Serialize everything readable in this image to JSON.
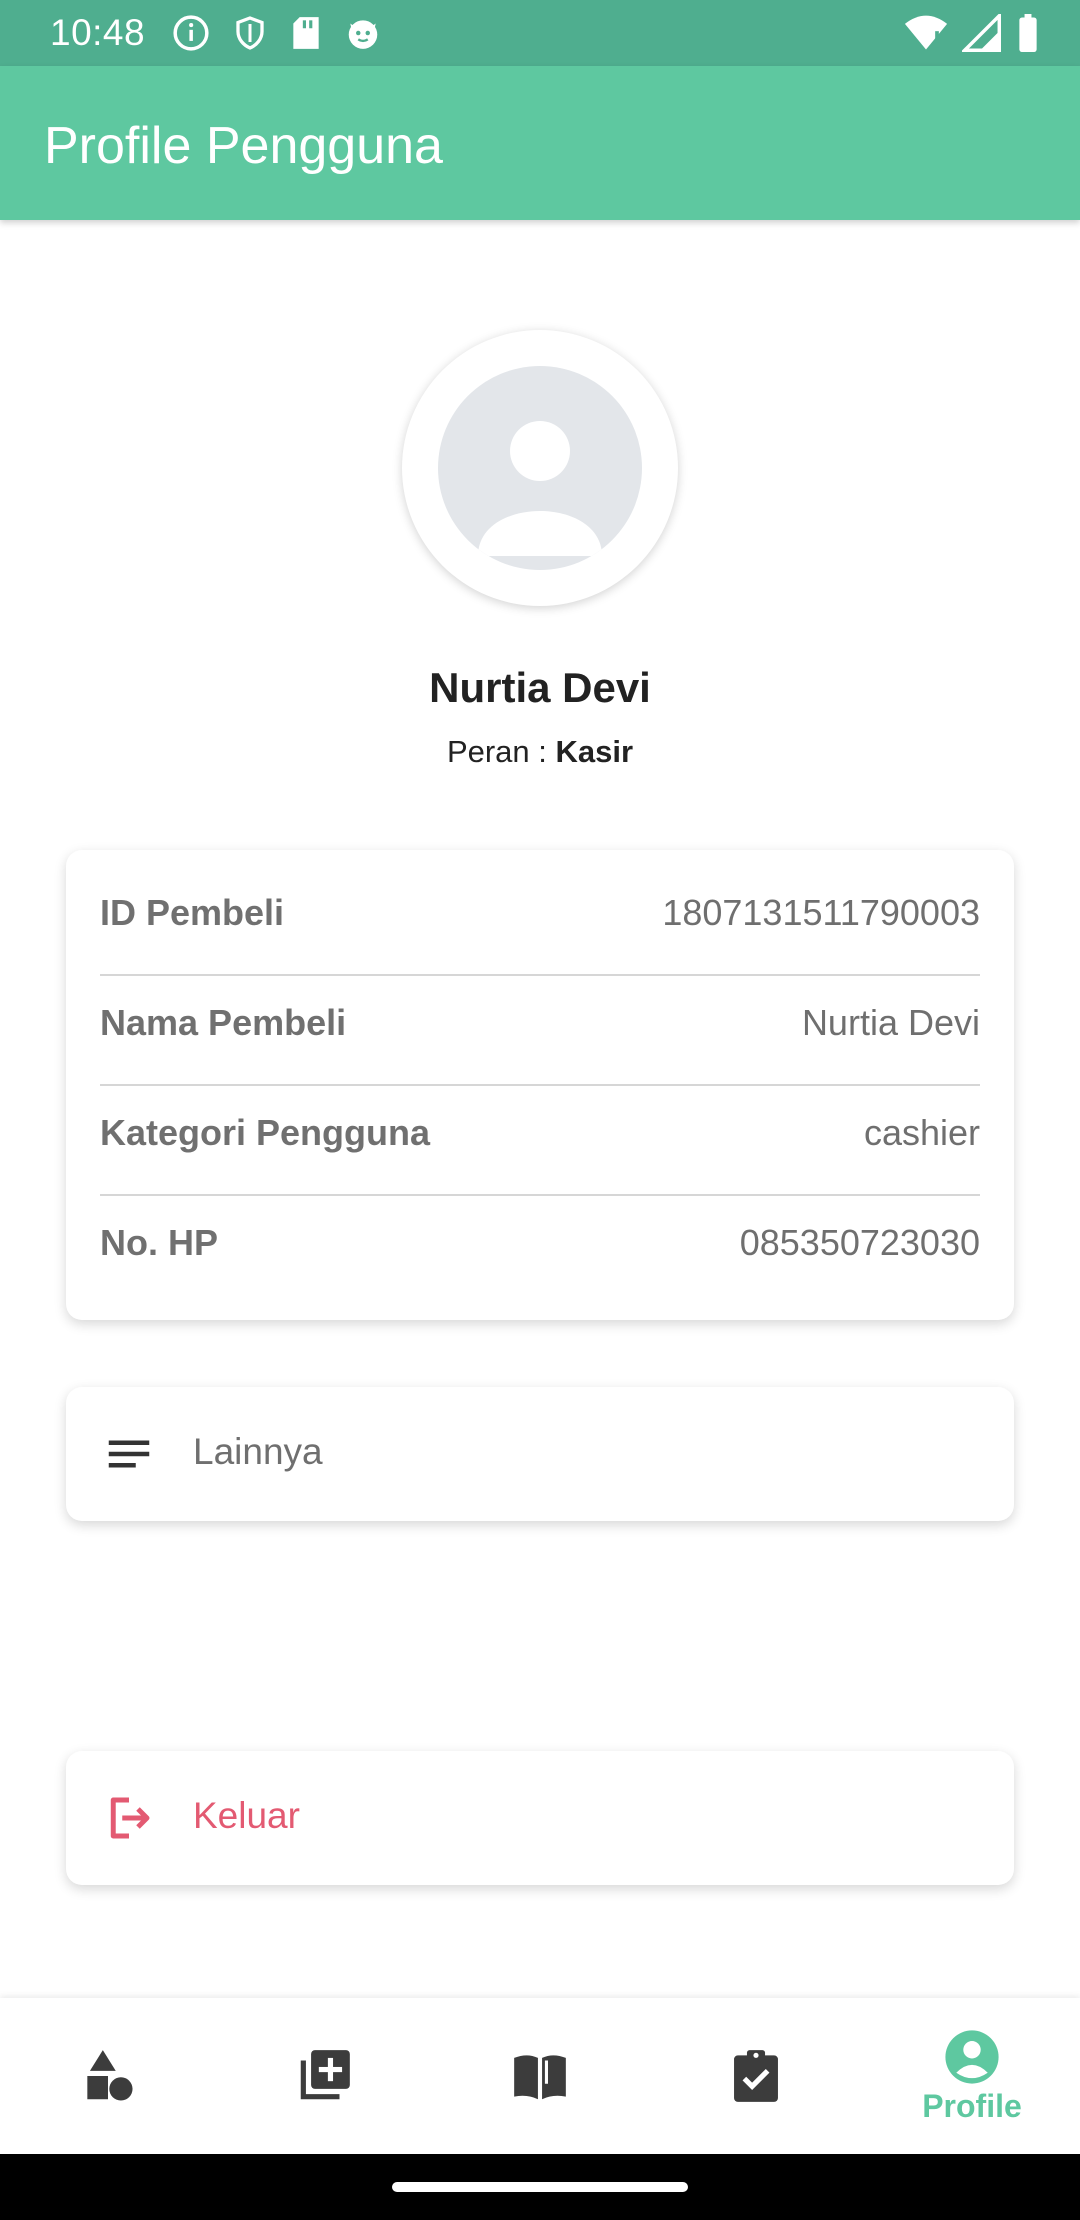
{
  "status_bar": {
    "time": "10:48",
    "left_icons": [
      "info-icon",
      "shield-icon",
      "sd-card-icon",
      "cat-face-icon"
    ],
    "right_icons": [
      "wifi-icon",
      "signal-icon",
      "battery-icon"
    ]
  },
  "app_bar": {
    "title": "Profile Pengguna"
  },
  "profile": {
    "name": "Nurtia Devi",
    "role_prefix": "Peran : ",
    "role_value": "Kasir"
  },
  "info": {
    "rows": [
      {
        "label": "ID Pembeli",
        "value": "1807131511790003"
      },
      {
        "label": "Nama Pembeli",
        "value": "Nurtia Devi"
      },
      {
        "label": "Kategori Pengguna",
        "value": "cashier"
      },
      {
        "label": "No. HP",
        "value": "085350723030"
      }
    ]
  },
  "menu": {
    "more_label": "Lainnya",
    "logout_label": "Keluar"
  },
  "bottom_nav": {
    "items": [
      {
        "icon": "shapes-icon",
        "label": ""
      },
      {
        "icon": "add-box-icon",
        "label": ""
      },
      {
        "icon": "book-icon",
        "label": ""
      },
      {
        "icon": "clipboard-check-icon",
        "label": ""
      },
      {
        "icon": "account-circle-icon",
        "label": "Profile"
      }
    ],
    "active_color": "#5ec8a0",
    "inactive_color": "#3c3c3c"
  },
  "colors": {
    "primary": "#5ec8a0",
    "status_bar": "#4fae8f",
    "logout": "#e35a72"
  }
}
